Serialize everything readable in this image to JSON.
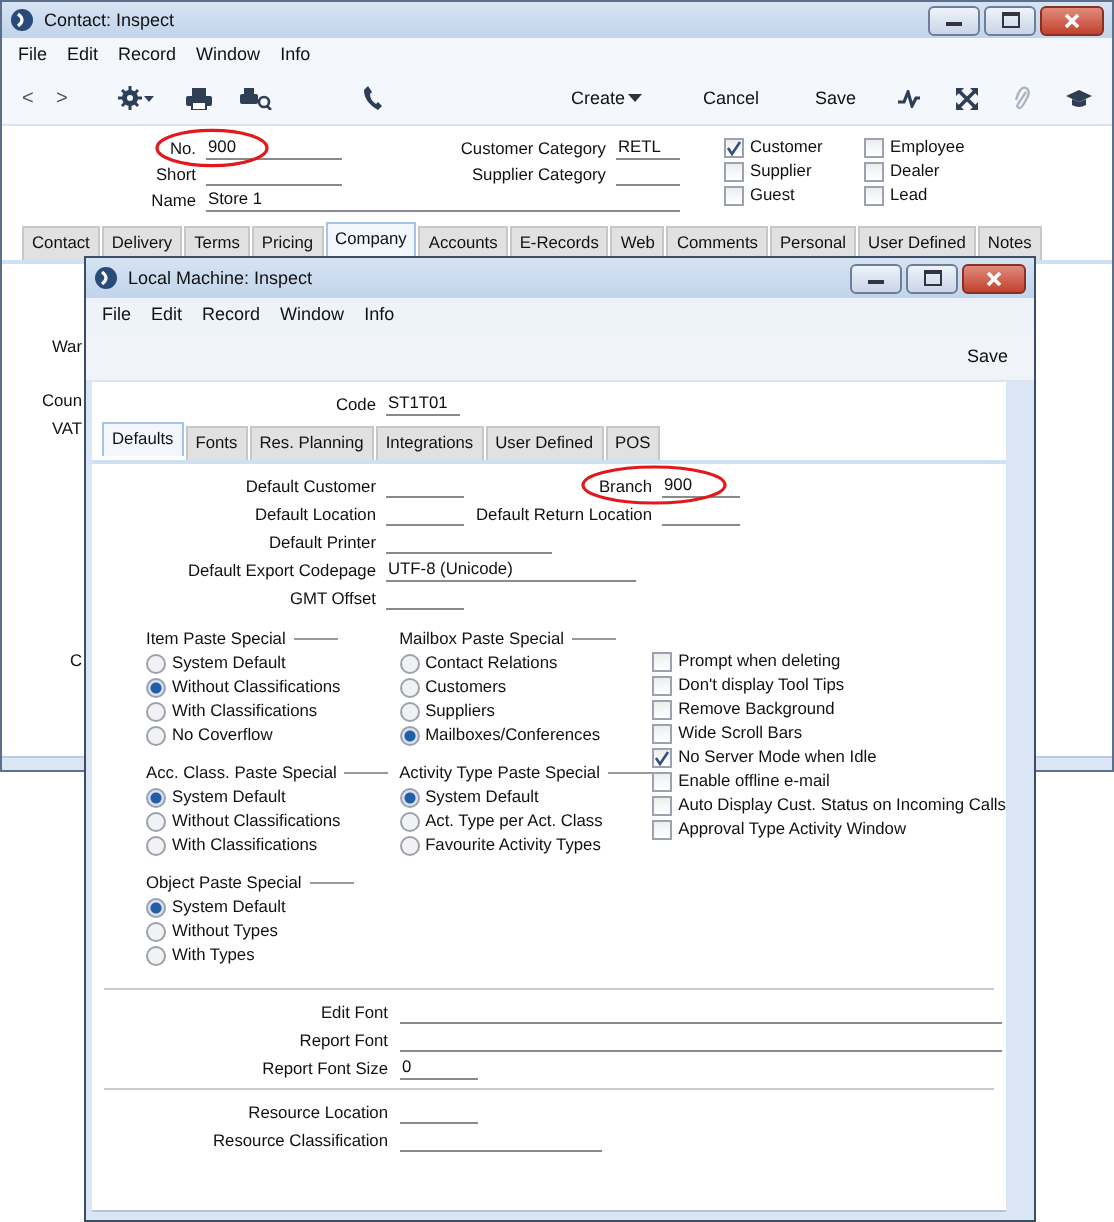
{
  "back_window": {
    "title": "Contact: Inspect",
    "menu": [
      "File",
      "Edit",
      "Record",
      "Window",
      "Info"
    ],
    "toolbar": {
      "nav": [
        "<",
        ">"
      ],
      "create": "Create",
      "cancel": "Cancel",
      "save": "Save"
    },
    "fields": [
      {
        "label": "No.",
        "value": "900"
      },
      {
        "label": "Short"
      },
      {
        "label": "Name",
        "value": "Store 1"
      }
    ],
    "categories": [
      {
        "label": "Customer Category",
        "value": "RETL"
      },
      {
        "label": "Supplier Category"
      }
    ],
    "checkboxes": [
      {
        "label": "Customer",
        "checked": true
      },
      {
        "label": "Supplier",
        "checked": false
      },
      {
        "label": "Guest",
        "checked": false
      },
      {
        "label": "Employee",
        "checked": false
      },
      {
        "label": "Dealer",
        "checked": false
      },
      {
        "label": "Lead",
        "checked": false
      }
    ],
    "tabs": [
      {
        "label": "Contact",
        "selected": false
      },
      {
        "label": "Delivery",
        "selected": false
      },
      {
        "label": "Terms",
        "selected": false
      },
      {
        "label": "Pricing",
        "selected": false
      },
      {
        "label": "Company",
        "selected": true
      },
      {
        "label": "Accounts",
        "selected": false
      },
      {
        "label": "E-Records",
        "selected": false
      },
      {
        "label": "Web",
        "selected": false
      },
      {
        "label": "Comments",
        "selected": false
      },
      {
        "label": "Personal",
        "selected": false
      },
      {
        "label": "User Defined",
        "selected": false
      },
      {
        "label": "Notes",
        "selected": false
      }
    ],
    "partial_labels": [
      "War",
      "Coun",
      "VAT",
      "C"
    ]
  },
  "front_window": {
    "title": "Local Machine: Inspect",
    "menu": [
      "File",
      "Edit",
      "Record",
      "Window",
      "Info"
    ],
    "save": "Save",
    "code": {
      "label": "Code",
      "value": "ST1T01"
    },
    "tabs": [
      {
        "label": "Defaults",
        "selected": true
      },
      {
        "label": "Fonts",
        "selected": false
      },
      {
        "label": "Res. Planning",
        "selected": false
      },
      {
        "label": "Integrations",
        "selected": false
      },
      {
        "label": "User Defined",
        "selected": false
      },
      {
        "label": "POS",
        "selected": false
      }
    ],
    "default_customer": {
      "label": "Default Customer"
    },
    "branch": {
      "label": "Branch",
      "value": "900"
    },
    "default_location": {
      "label": "Default Location"
    },
    "default_return_location": {
      "label": "Default Return Location"
    },
    "default_printer": {
      "label": "Default Printer"
    },
    "export_codepage": {
      "label": "Default Export Codepage",
      "value": "UTF-8 (Unicode)"
    },
    "gmt_offset": {
      "label": "GMT Offset"
    },
    "radio_columns": [
      [
        {
          "title": "Item Paste Special",
          "options": [
            {
              "label": "System Default",
              "selected": false
            },
            {
              "label": "Without Classifications",
              "selected": true
            },
            {
              "label": "With Classifications",
              "selected": false
            },
            {
              "label": "No Coverflow",
              "selected": false
            }
          ]
        },
        {
          "title": "Acc. Class. Paste Special",
          "options": [
            {
              "label": "System Default",
              "selected": true
            },
            {
              "label": "Without Classifications",
              "selected": false
            },
            {
              "label": "With Classifications",
              "selected": false
            }
          ]
        },
        {
          "title": "Object Paste Special",
          "options": [
            {
              "label": "System Default",
              "selected": true
            },
            {
              "label": "Without Types",
              "selected": false
            },
            {
              "label": "With Types",
              "selected": false
            }
          ]
        }
      ],
      [
        {
          "title": "Mailbox Paste Special",
          "options": [
            {
              "label": "Contact Relations",
              "selected": false
            },
            {
              "label": "Customers",
              "selected": false
            },
            {
              "label": "Suppliers",
              "selected": false
            },
            {
              "label": "Mailboxes/Conferences",
              "selected": true
            }
          ]
        },
        {
          "title": "Activity Type Paste Special",
          "options": [
            {
              "label": "System Default",
              "selected": true
            },
            {
              "label": "Act. Type per Act. Class",
              "selected": false
            },
            {
              "label": "Favourite Activity Types",
              "selected": false
            }
          ]
        }
      ]
    ],
    "options": [
      {
        "label": "Prompt when deleting",
        "checked": false
      },
      {
        "label": "Don't display Tool Tips",
        "checked": false
      },
      {
        "label": "Remove Background",
        "checked": false
      },
      {
        "label": "Wide Scroll Bars",
        "checked": false
      },
      {
        "label": "No Server Mode when Idle",
        "checked": true
      },
      {
        "label": "Enable offline e-mail",
        "checked": false
      },
      {
        "label": "Auto Display Cust. Status on Incoming Calls",
        "checked": false
      },
      {
        "label": "Approval Type Activity Window",
        "checked": false
      }
    ],
    "font_fields": [
      {
        "label": "Edit Font"
      },
      {
        "label": "Report Font"
      },
      {
        "label": "Report Font Size",
        "value": "0"
      }
    ],
    "resource_fields": [
      {
        "label": "Resource Location"
      },
      {
        "label": "Resource Classification"
      }
    ]
  }
}
